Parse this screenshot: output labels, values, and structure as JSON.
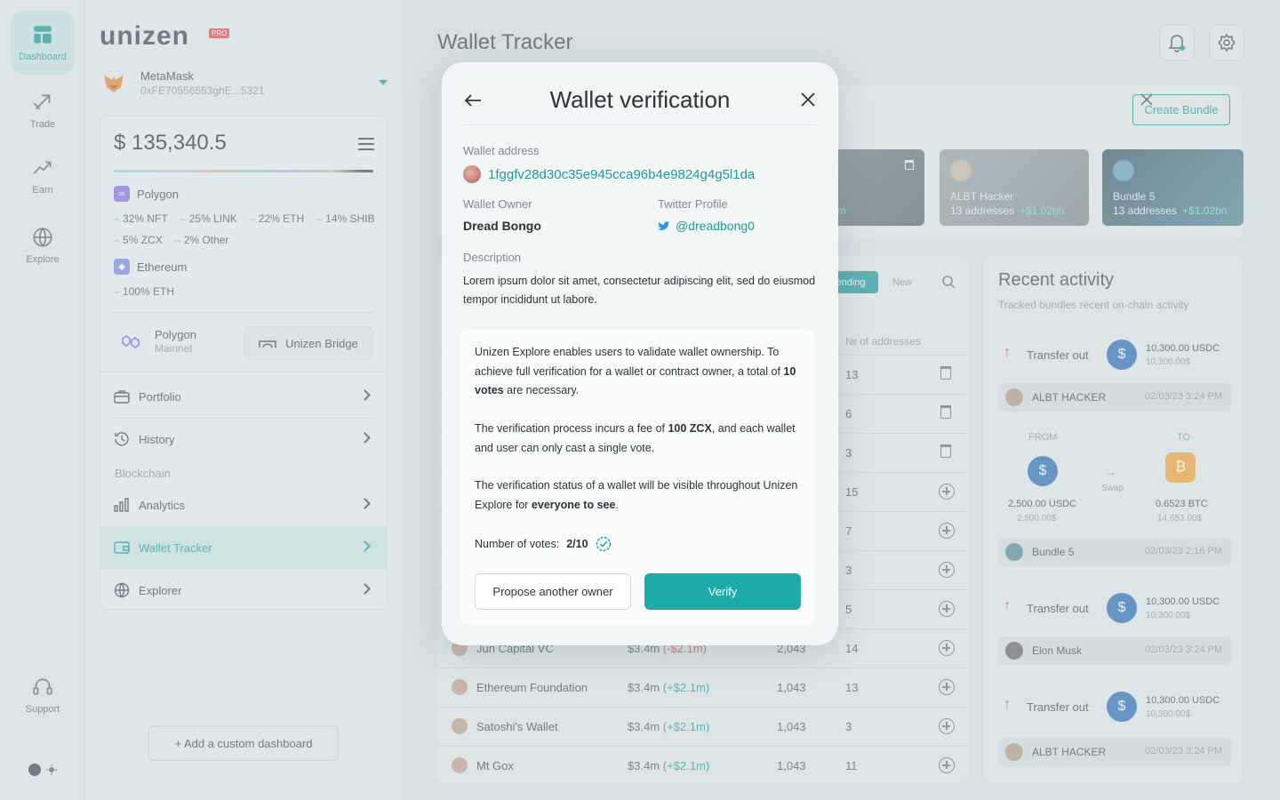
{
  "rail": {
    "items": [
      {
        "label": "Dashboard",
        "icon": "dashboard-icon"
      },
      {
        "label": "Trade",
        "icon": "trade-icon"
      },
      {
        "label": "Earn",
        "icon": "earn-icon"
      },
      {
        "label": "Explore",
        "icon": "globe-icon"
      },
      {
        "label": "Support",
        "icon": "headset-icon"
      }
    ]
  },
  "brand": {
    "name": "unizen",
    "badge": "PRO"
  },
  "wallet": {
    "name": "MetaMask",
    "address": "0xFE70556553ghE...5321"
  },
  "portfolio": {
    "balance": "$ 135,340.5",
    "chains": [
      {
        "name": "Polygon",
        "allocations_1": [
          "32% NFT",
          "25% LINK",
          "22% ETH",
          "14% SHIB"
        ],
        "allocations_2": [
          "5% ZCX",
          "2% Other"
        ]
      },
      {
        "name": "Ethereum",
        "allocations_1": [
          "100% ETH"
        ]
      }
    ],
    "network": {
      "name": "Polygon",
      "sub": "Mainnet"
    },
    "bridge_label": "Unizen Bridge"
  },
  "nav": {
    "portfolio": "Portfolio",
    "history": "History",
    "section": "Blockchain",
    "analytics": "Analytics",
    "wallet_tracker": "Wallet Tracker",
    "explorer": "Explorer"
  },
  "add_dashboard": "+ Add a custom dashboard",
  "page": {
    "title": "Wallet Tracker"
  },
  "bundles": {
    "create_label": "Create Bundle",
    "cards": [
      {
        "name": "",
        "sub": "es",
        "gain": "+$25.1m"
      },
      {
        "name": "ALBT Hacker",
        "sub": "13 addresses",
        "gain": "+$1.02bn"
      },
      {
        "name": "Bundle 5",
        "sub": "13 addresses",
        "gain": "+$1.02bn"
      }
    ]
  },
  "table": {
    "tab_pending": "ending",
    "tab_new": "New",
    "col_addresses": "№ of addresses",
    "rows": [
      {
        "name": "",
        "value": "",
        "gain": "",
        "tx": "",
        "addr": "13",
        "action": "delete"
      },
      {
        "name": "",
        "value": "",
        "gain": "",
        "tx": "",
        "addr": "6",
        "action": "delete"
      },
      {
        "name": "",
        "value": "",
        "gain": "",
        "tx": "",
        "addr": "3",
        "action": "delete"
      },
      {
        "name": "",
        "value": "",
        "gain": "",
        "tx": "",
        "addr": "15",
        "action": "add"
      },
      {
        "name": "",
        "value": "",
        "gain": "",
        "tx": "",
        "addr": "7",
        "action": "add"
      },
      {
        "name": "",
        "value": "",
        "gain": "",
        "tx": "",
        "addr": "3",
        "action": "add"
      },
      {
        "name": "",
        "value": "",
        "gain": "",
        "tx": "",
        "addr": "5",
        "action": "add"
      },
      {
        "name": "Jun Capital VC",
        "value": "$3.4m",
        "gain": "(-$2.1m)",
        "tx": "2,043",
        "addr": "14",
        "action": "add"
      },
      {
        "name": "Ethereum Foundation",
        "value": "$3.4m",
        "gain": "(+$2.1m)",
        "tx": "1,043",
        "addr": "13",
        "action": "add"
      },
      {
        "name": "Satoshi's Wallet",
        "value": "$3.4m",
        "gain": "(+$2.1m)",
        "tx": "1,043",
        "addr": "3",
        "action": "add"
      },
      {
        "name": "Mt Gox",
        "value": "$3.4m",
        "gain": "(+$2.1m)",
        "tx": "1,043",
        "addr": "11",
        "action": "add"
      }
    ]
  },
  "activity": {
    "title": "Recent activity",
    "subtitle": "Tracked bundles recent on-chain activity",
    "transfer_label": "Transfer out",
    "amount": "10,300.00 USDC",
    "amount_usd": "10,300.00$",
    "owners": [
      {
        "name": "ALBT HACKER",
        "date": "02/03/23 3:24 PM"
      },
      {
        "name": "Bundle 5",
        "date": "02/03/23 2:16 PM"
      },
      {
        "name": "Elon Musk",
        "date": "02/03/23 3:24 PM"
      },
      {
        "name": "ALBT HACKER",
        "date": "02/03/23 3:24 PM"
      }
    ],
    "swap": {
      "from_label": "FROM",
      "to_label": "TO",
      "swap_label": "Swap",
      "from_amount": "2,500.00 USDC",
      "from_usd": "2,500.00$",
      "to_amount": "0.6523 BTC",
      "to_usd": "14,653.00$"
    }
  },
  "modal": {
    "title": "Wallet verification",
    "wallet_address_label": "Wallet address",
    "wallet_address": "1fggfv28d30c35e945cca96b4e9824g4g5l1da",
    "owner_label": "Wallet Owner",
    "owner": "Dread Bongo",
    "twitter_label": "Twitter Profile",
    "twitter": "@dreadbong0",
    "description_label": "Description",
    "description": "Lorem ipsum dolor sit amet, consectetur adipiscing elit, sed do eiusmod tempor incididunt ut labore.",
    "info_1a": "Unizen Explore enables users to validate wallet ownership. To achieve full verification for a wallet or contract owner, a total of ",
    "info_1b": "10 votes",
    "info_1c": " are necessary.",
    "info_2a": "The verification process incurs a fee of ",
    "info_2b": "100 ZCX",
    "info_2c": ", and each wallet and user can only cast a single vote.",
    "info_3a": "The verification status of a wallet will be visible throughout Unizen Explore for ",
    "info_3b": "everyone to see",
    "info_3c": ".",
    "votes_label": "Number of votes:",
    "votes_value": "2/10",
    "propose_label": "Propose another owner",
    "verify_label": "Verify"
  }
}
